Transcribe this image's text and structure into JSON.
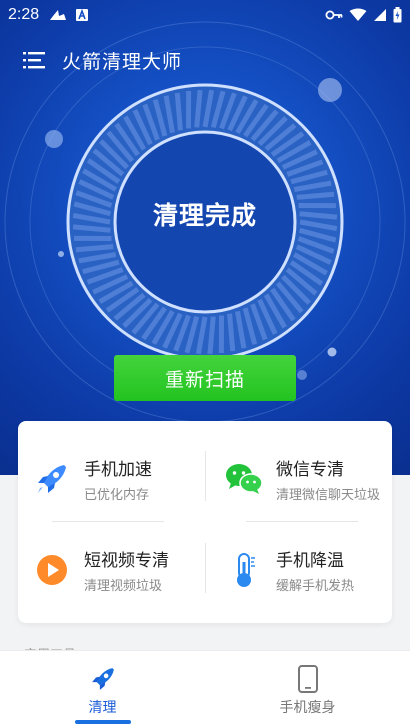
{
  "status_bar": {
    "time": "2:28",
    "left_icons": [
      "dock-icon",
      "text-a-icon"
    ],
    "right_icons": [
      "key-icon",
      "wifi-icon",
      "signal-icon",
      "battery-icon"
    ]
  },
  "app_bar": {
    "menu_icon": "menu-icon",
    "title": "火箭清理大师"
  },
  "hero": {
    "status_text": "清理完成",
    "rescan_label": "重新扫描",
    "accent_color": "#2ecb2b",
    "background_color": "#1450c4"
  },
  "features": [
    {
      "title": "手机加速",
      "subtitle": "已优化内存",
      "icon": "rocket-icon"
    },
    {
      "title": "微信专清",
      "subtitle": "清理微信聊天垃圾",
      "icon": "wechat-icon"
    },
    {
      "title": "短视频专清",
      "subtitle": "清理视频垃圾",
      "icon": "play-icon"
    },
    {
      "title": "手机降温",
      "subtitle": "缓解手机发热",
      "icon": "thermometer-icon"
    }
  ],
  "section": {
    "label": "实用工具"
  },
  "bottom_nav": {
    "items": [
      {
        "label": "清理",
        "icon": "rocket-icon",
        "active": true
      },
      {
        "label": "手机瘦身",
        "icon": "phone-icon",
        "active": false
      }
    ],
    "active_color": "#1a5bd6"
  }
}
